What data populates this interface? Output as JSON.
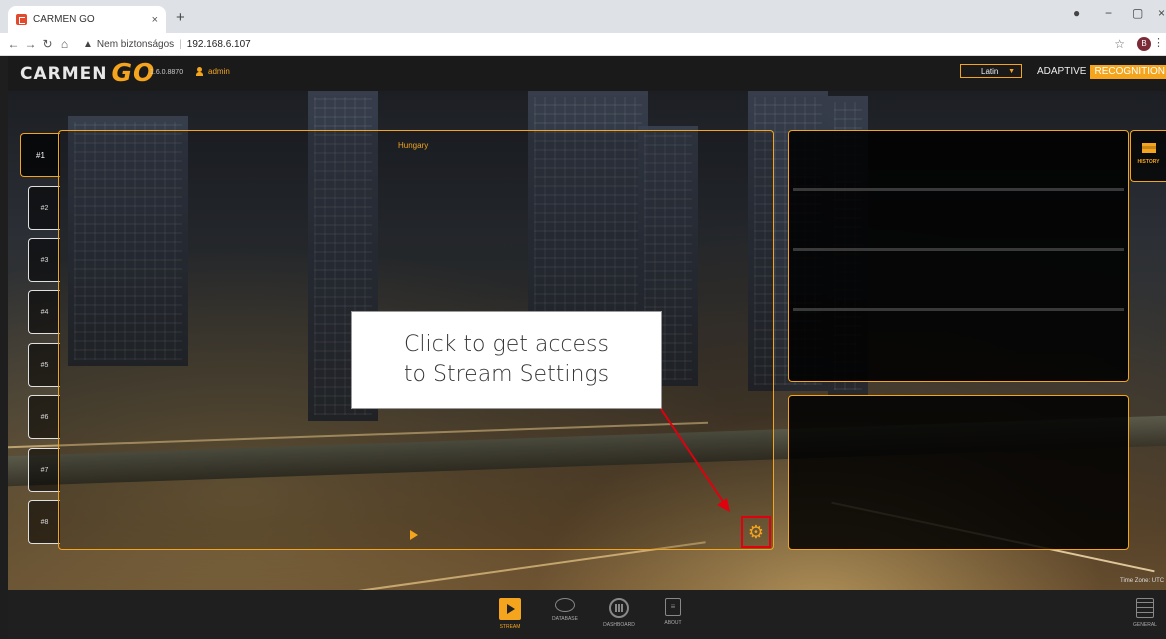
{
  "browser": {
    "tab_title": "CARMEN GO",
    "tab_close": "×",
    "new_tab": "+",
    "security_label": "Nem biztonságos",
    "url": "192.168.6.107",
    "profile_initial": "B"
  },
  "header": {
    "logo_text": "CARMEN",
    "logo_suffix": "GO",
    "version": "1.6.0.8870",
    "username": "admin",
    "language": "Latin",
    "brand_part1": "ADAPTIVE",
    "brand_part2": "RECOGNITION",
    "accent_color": "#f4a51d"
  },
  "camera_tabs": [
    "#1",
    "#2",
    "#3",
    "#4",
    "#5",
    "#6",
    "#7",
    "#8"
  ],
  "active_camera": "#1",
  "stream": {
    "country": "Hungary",
    "play_icon": "play-icon",
    "settings_icon": "gear-icon"
  },
  "callout": {
    "line1": "Click to get access",
    "line2": "to Stream Settings",
    "highlight_color": "#e0000e"
  },
  "history": {
    "label": "HISTORY",
    "icon": "history-icon"
  },
  "timezone": "Time Zone: UTC",
  "bottom_nav": {
    "items": [
      {
        "label": "STREAM",
        "icon": "stream-icon"
      },
      {
        "label": "DATABASE",
        "icon": "database-icon"
      },
      {
        "label": "DASHBOARD",
        "icon": "dashboard-icon"
      },
      {
        "label": "ABOUT",
        "icon": "about-icon"
      }
    ],
    "general": {
      "label": "GENERAL",
      "icon": "general-settings-icon"
    }
  }
}
